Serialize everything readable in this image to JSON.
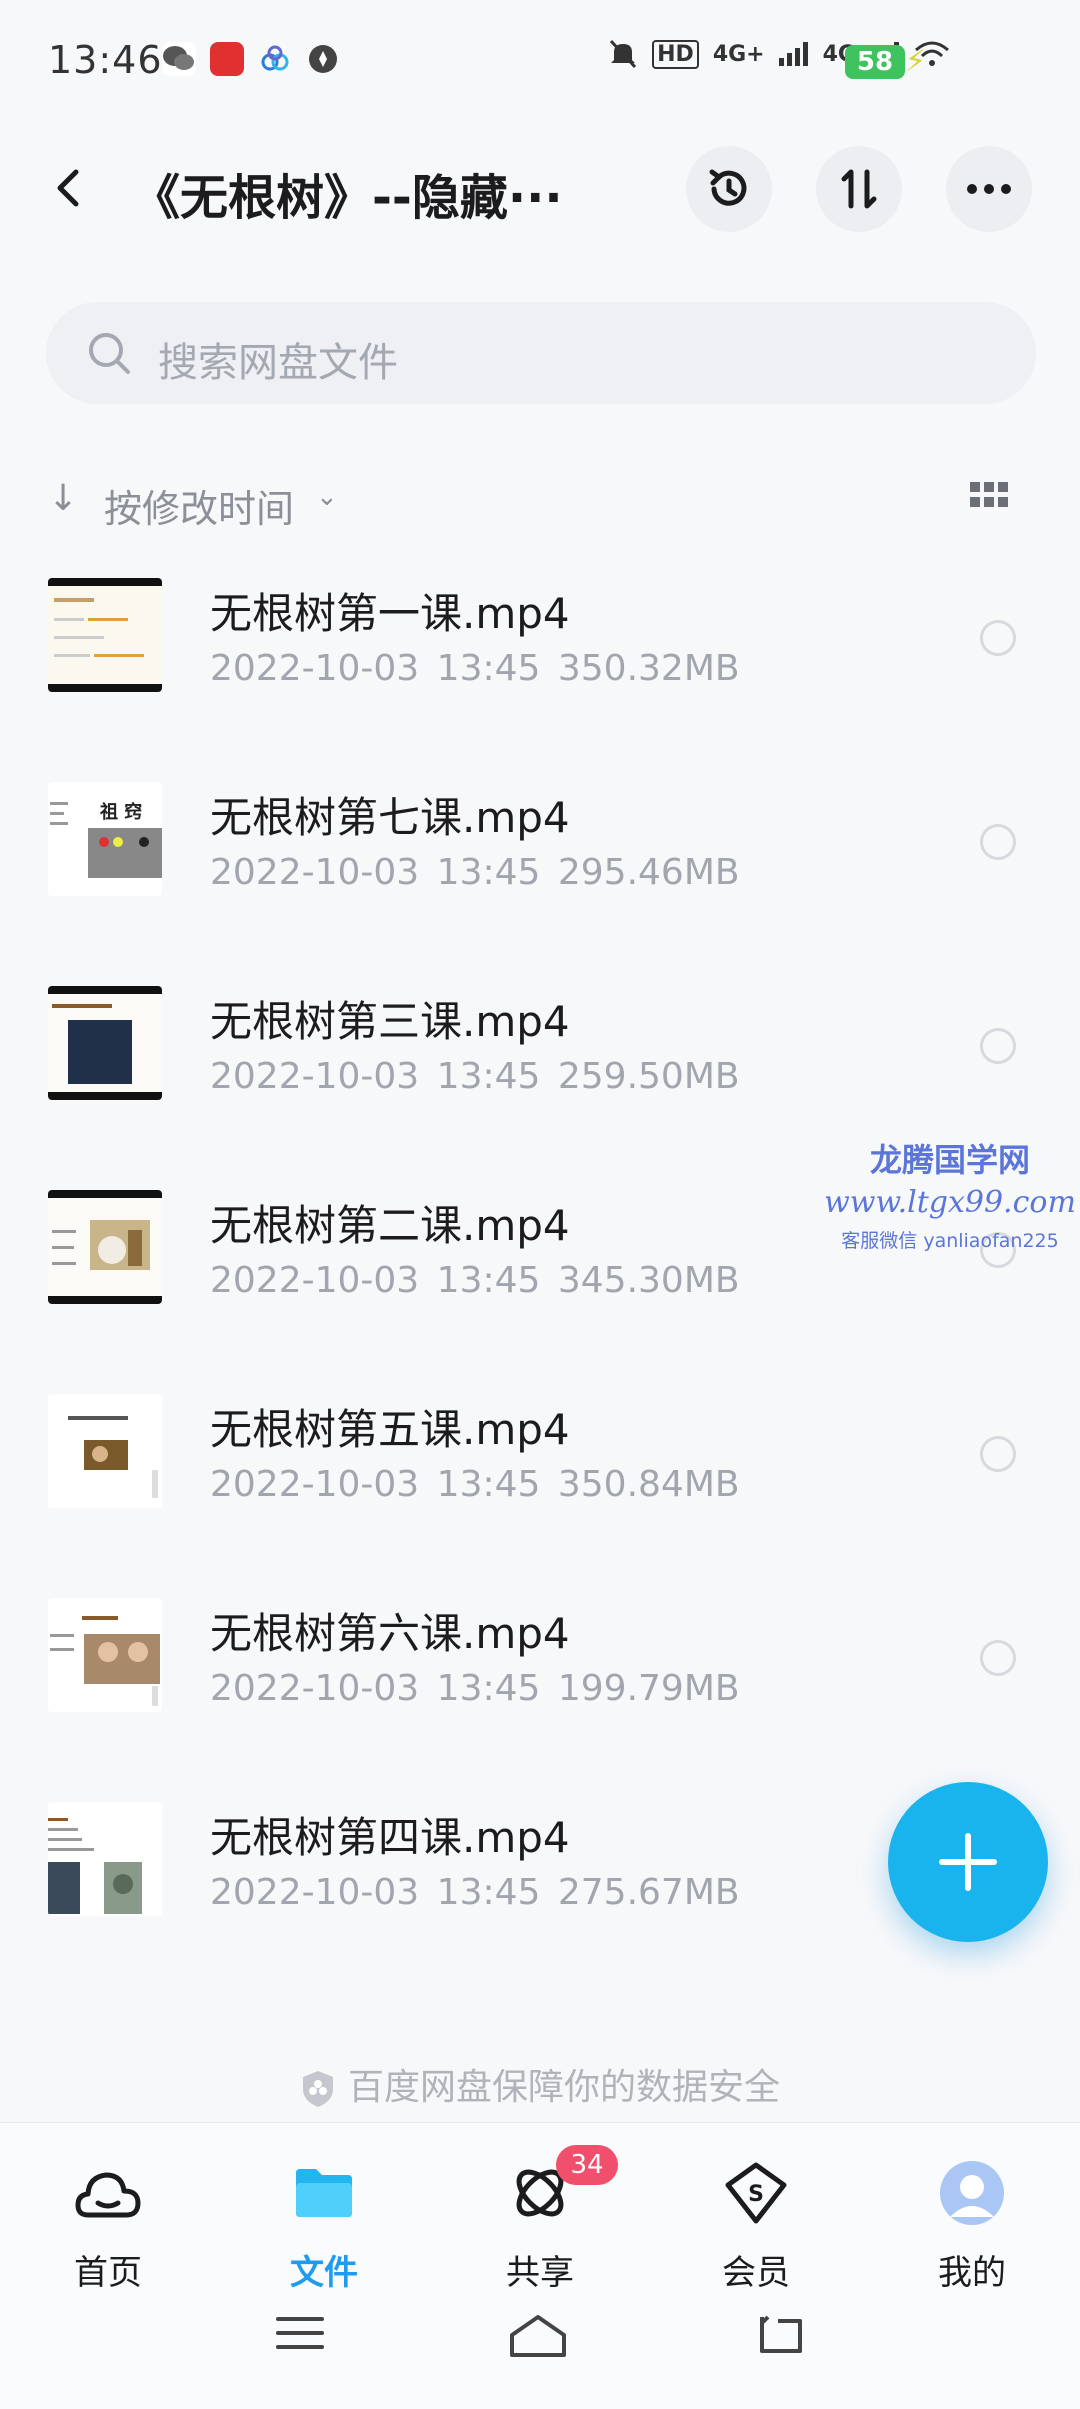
{
  "status_bar": {
    "time": "13:46",
    "network_left": "HD",
    "network_a": "4G+",
    "network_b": "4G",
    "battery": "58"
  },
  "header": {
    "title": "《无根树》--隐藏···",
    "back_icon": "back-arrow-icon",
    "history_icon": "history-icon",
    "transfer_icon": "transfer-icon",
    "more_icon": "more-icon"
  },
  "search": {
    "placeholder": "搜索网盘文件"
  },
  "sort": {
    "label": "按修改时间"
  },
  "files": [
    {
      "name": "无根树第一课.mp4",
      "date": "2022-10-03",
      "time": "13:45",
      "size": "350.32MB"
    },
    {
      "name": "无根树第七课.mp4",
      "date": "2022-10-03",
      "time": "13:45",
      "size": "295.46MB"
    },
    {
      "name": "无根树第三课.mp4",
      "date": "2022-10-03",
      "time": "13:45",
      "size": "259.50MB"
    },
    {
      "name": "无根树第二课.mp4",
      "date": "2022-10-03",
      "time": "13:45",
      "size": "345.30MB"
    },
    {
      "name": "无根树第五课.mp4",
      "date": "2022-10-03",
      "time": "13:45",
      "size": "350.84MB"
    },
    {
      "name": "无根树第六课.mp4",
      "date": "2022-10-03",
      "time": "13:45",
      "size": "199.79MB"
    },
    {
      "name": "无根树第四课.mp4",
      "date": "2022-10-03",
      "time": "13:45",
      "size": "275.67MB"
    }
  ],
  "watermark": {
    "line1": "龙腾国学网",
    "line2": "www.ltgx99.com",
    "line3": "客服微信 yanliaofan225"
  },
  "safety_text": "百度网盘保障你的数据安全",
  "nav": {
    "home": "首页",
    "files": "文件",
    "share": "共享",
    "share_badge": "34",
    "vip": "会员",
    "me": "我的"
  },
  "colors": {
    "accent": "#1f9cf0",
    "fab": "#19b3ee",
    "badge": "#f0506c",
    "battery": "#3ec35e"
  }
}
